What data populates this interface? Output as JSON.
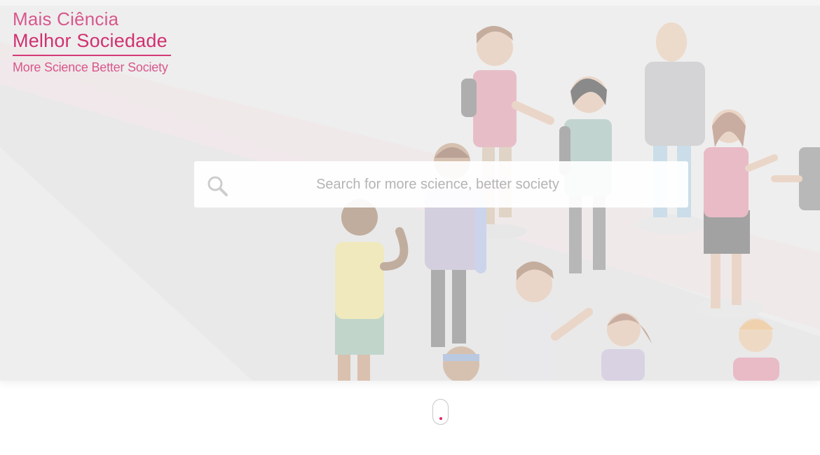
{
  "logo": {
    "line1": "Mais Ciência",
    "line2": "Melhor Sociedade",
    "line3": "More Science Better Society"
  },
  "search": {
    "placeholder": "Search for more science, better society",
    "value": "",
    "icon": "search-icon"
  },
  "scroll_indicator": {
    "icon": "mouse-scroll-icon"
  },
  "colors": {
    "brand": "#d1266a",
    "hero_background": "#efefef",
    "placeholder": "#b4b4b4"
  }
}
